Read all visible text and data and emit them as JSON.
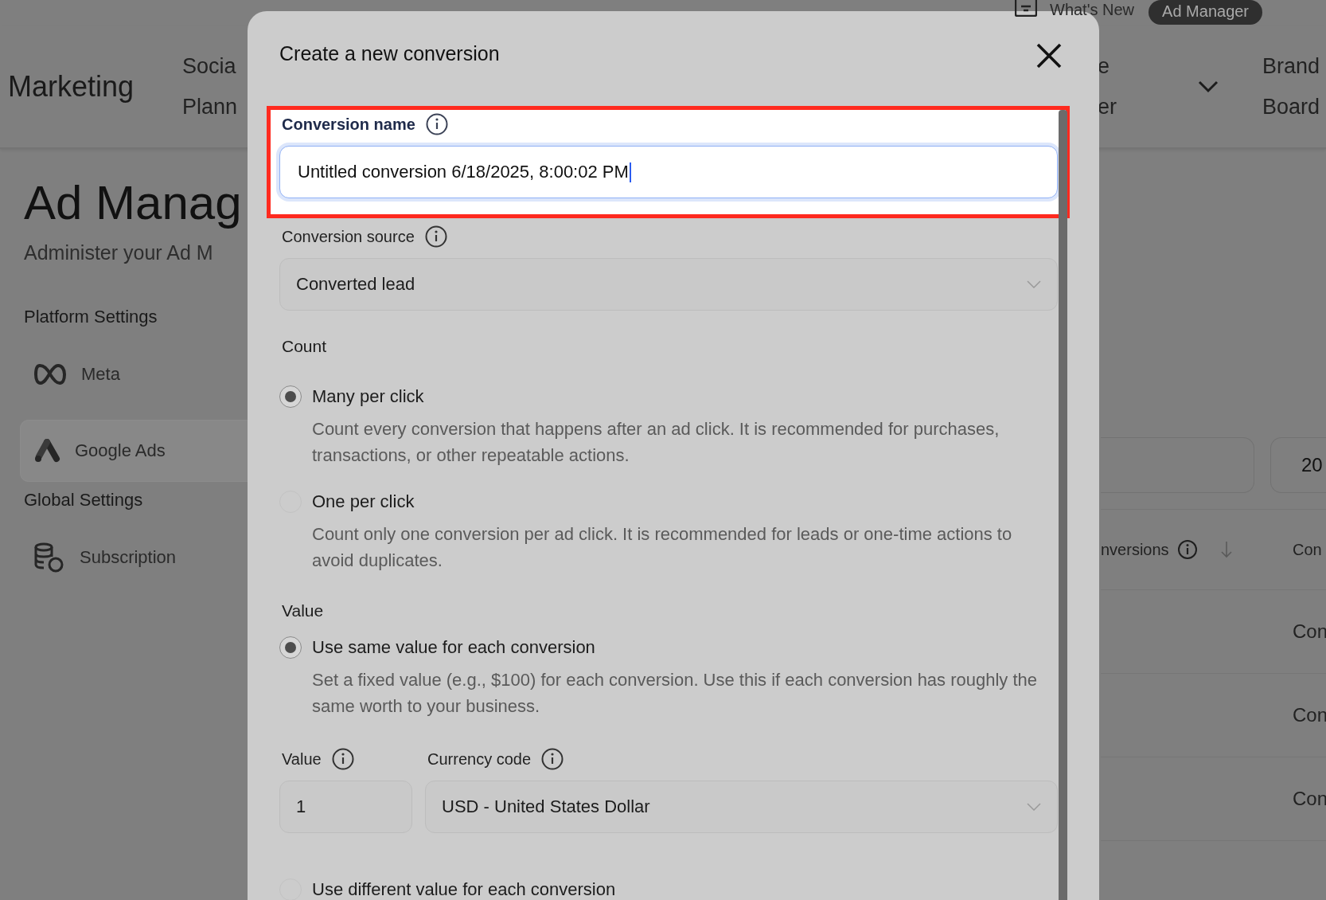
{
  "top_bar": {
    "whats_new": "What's New",
    "active_pill": "Ad Manager"
  },
  "header": {
    "brand": "Marketing",
    "nav_left": [
      "Socia",
      "Plann"
    ],
    "nav_middle": [
      "e",
      "er"
    ],
    "nav_right": [
      "Brand",
      "Board"
    ]
  },
  "page": {
    "title": "Ad Manag",
    "subtitle": "Administer your Ad M"
  },
  "sidebar": {
    "sections": [
      {
        "heading": "Platform Settings",
        "items": [
          {
            "label": "Meta",
            "selected": false
          },
          {
            "label": "Google Ads",
            "selected": true
          }
        ]
      },
      {
        "heading": "Global Settings",
        "items": [
          {
            "label": "Subscription",
            "selected": false
          }
        ]
      }
    ]
  },
  "filters": {
    "field_2_value": "20"
  },
  "table": {
    "columns": [
      {
        "label": "nversions",
        "info": true,
        "sortable": true
      },
      {
        "label": "Con"
      }
    ],
    "rows": [
      {
        "column_2": "Con"
      },
      {
        "column_2": "Con"
      },
      {
        "column_2": "Con"
      }
    ]
  },
  "modal": {
    "title": "Create a new conversion",
    "name_field": {
      "label": "Conversion name",
      "info": true,
      "value": "Untitled conversion 6/18/2025, 8:00:02 PM",
      "highlighted": true
    },
    "source_field": {
      "label": "Conversion source",
      "info": true,
      "value": "Converted lead"
    },
    "count": {
      "heading": "Count",
      "options": [
        {
          "label": "Many per click",
          "description": "Count every conversion that happens after an ad click. It is recommended for purchases, transactions, or other repeatable actions.",
          "selected": true
        },
        {
          "label": "One per click",
          "description": "Count only one conversion per ad click. It is recommended for leads or one-time actions to avoid duplicates.",
          "selected": false
        }
      ]
    },
    "value": {
      "heading": "Value",
      "options": [
        {
          "label": "Use same value for each conversion",
          "description": "Set a fixed value (e.g., $100) for each conversion. Use this if each conversion has roughly the same worth to your business.",
          "selected": true
        },
        {
          "label": "Use different value for each conversion",
          "selected": false
        }
      ],
      "value_field": {
        "label": "Value",
        "info": true,
        "value": "1"
      },
      "currency_field": {
        "label": "Currency code",
        "info": true,
        "value": "USD - United States Dollar"
      }
    }
  }
}
